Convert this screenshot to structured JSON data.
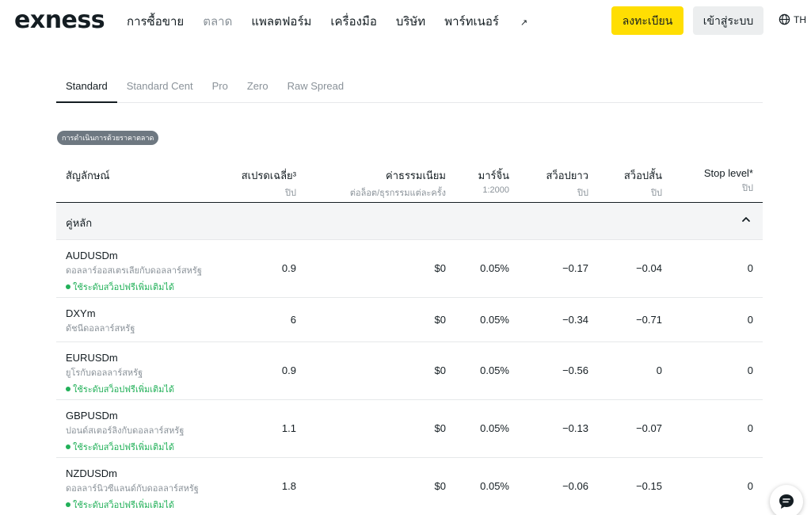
{
  "header": {
    "logo": "exness",
    "nav": [
      {
        "label": "การซื้อขาย",
        "muted": false
      },
      {
        "label": "ตลาด",
        "muted": true
      },
      {
        "label": "แพลตฟอร์ม",
        "muted": false
      },
      {
        "label": "เครื่องมือ",
        "muted": false
      },
      {
        "label": "บริษัท",
        "muted": false
      },
      {
        "label": "พาร์ทเนอร์",
        "muted": false
      }
    ],
    "partner_ext_icon": "↗",
    "signup_label": "ลงทะเบียน",
    "login_label": "เข้าสู่ระบบ",
    "lang_label": "TH",
    "accent_color": "#ffde02"
  },
  "tabs": [
    {
      "label": "Standard",
      "active": true
    },
    {
      "label": "Standard Cent",
      "active": false
    },
    {
      "label": "Pro",
      "active": false
    },
    {
      "label": "Zero",
      "active": false
    },
    {
      "label": "Raw Spread",
      "active": false
    }
  ],
  "badge": "การดำเนินการด้วยราคาตลาด",
  "table": {
    "headers": {
      "symbol": "สัญลักษณ์",
      "spread": "สเปรดเฉลี่ย³",
      "spread_unit": "ปิป",
      "commission": "ค่าธรรมเนียม",
      "commission_unit": "ต่อล็อต/ธุรกรรมแต่ละครั้ง",
      "margin": "มาร์จิ้น",
      "margin_unit": "1:2000",
      "swap_long": "สว็อปยาว",
      "swap_long_unit": "ปิป",
      "swap_short": "สว็อปสั้น",
      "swap_short_unit": "ปิป",
      "stop_level": "Stop level*",
      "stop_level_unit": "ปิป"
    },
    "group_label": "คู่หลัก",
    "rows": [
      {
        "symbol": "AUDUSDm",
        "desc": "ดอลลาร์ออสเตรเลียกับดอลลาร์สหรัฐ",
        "swap_free": "ใช้ระดับสว็อปฟรีเพิ่มเติมได้",
        "spread": "0.9",
        "commission": "$0",
        "margin": "0.05%",
        "swap_long": "−0.17",
        "swap_short": "−0.04",
        "stop_level": "0"
      },
      {
        "symbol": "DXYm",
        "desc": "ดัชนีดอลลาร์สหรัฐ",
        "swap_free": "",
        "spread": "6",
        "commission": "$0",
        "margin": "0.05%",
        "swap_long": "−0.34",
        "swap_short": "−0.71",
        "stop_level": "0"
      },
      {
        "symbol": "EURUSDm",
        "desc": "ยูโรกับดอลลาร์สหรัฐ",
        "swap_free": "ใช้ระดับสว็อปฟรีเพิ่มเติมได้",
        "spread": "0.9",
        "commission": "$0",
        "margin": "0.05%",
        "swap_long": "−0.56",
        "swap_short": "0",
        "stop_level": "0"
      },
      {
        "symbol": "GBPUSDm",
        "desc": "ปอนด์สเตอร์ลิงกับดอลลาร์สหรัฐ",
        "swap_free": "ใช้ระดับสว็อปฟรีเพิ่มเติมได้",
        "spread": "1.1",
        "commission": "$0",
        "margin": "0.05%",
        "swap_long": "−0.13",
        "swap_short": "−0.07",
        "stop_level": "0"
      },
      {
        "symbol": "NZDUSDm",
        "desc": "ดอลลาร์นิวซีแลนด์กับดอลลาร์สหรัฐ",
        "swap_free": "ใช้ระดับสว็อปฟรีเพิ่มเติมได้",
        "spread": "1.8",
        "commission": "$0",
        "margin": "0.05%",
        "swap_long": "−0.06",
        "swap_short": "−0.15",
        "stop_level": "0"
      }
    ]
  },
  "icons": {
    "globe": "globe-icon",
    "chevron": "chevron-up-icon",
    "chat": "chat-icon",
    "dot": "status-dot-icon"
  }
}
